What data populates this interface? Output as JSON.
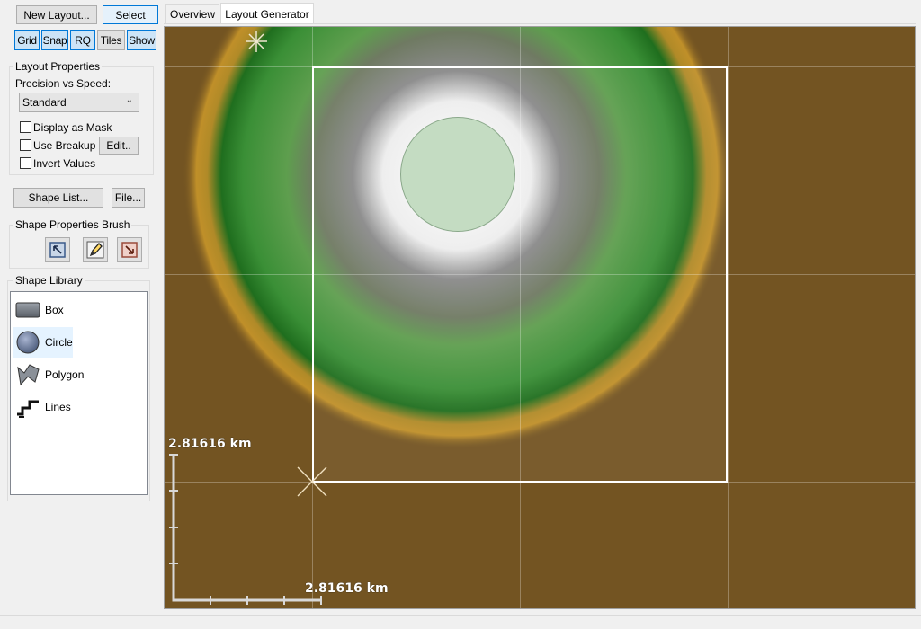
{
  "toolbar": {
    "new_layout": "New Layout...",
    "select": "Select",
    "toggles": [
      {
        "label": "Grid",
        "on": true
      },
      {
        "label": "Snap",
        "on": true
      },
      {
        "label": "RQ",
        "on": true
      },
      {
        "label": "Tiles",
        "on": false
      },
      {
        "label": "Show",
        "on": true
      }
    ]
  },
  "layout_properties": {
    "title": "Layout Properties",
    "precision_label": "Precision vs Speed:",
    "precision_value": "Standard",
    "display_as_mask": "Display as Mask",
    "use_breakup": "Use Breakup",
    "edit_button": "Edit..",
    "invert_values": "Invert Values"
  },
  "buttons": {
    "shape_list": "Shape List...",
    "file": "File..."
  },
  "brush": {
    "title": "Shape Properties Brush",
    "tools": [
      "select-brush-icon",
      "pencil-brush-icon",
      "erase-brush-icon"
    ]
  },
  "library": {
    "title": "Shape Library",
    "items": [
      {
        "label": "Box",
        "icon": "box-shape-icon"
      },
      {
        "label": "Circle",
        "icon": "circle-shape-icon",
        "selected": true
      },
      {
        "label": "Polygon",
        "icon": "polygon-shape-icon"
      },
      {
        "label": "Lines",
        "icon": "lines-shape-icon"
      }
    ]
  },
  "tabs": [
    {
      "label": "Overview",
      "active": false
    },
    {
      "label": "Layout Generator",
      "active": true
    }
  ],
  "viewport": {
    "scale_vertical": "2.81616 km",
    "scale_horizontal": "2.81616 km",
    "colors": {
      "terrain": "#735422",
      "ring_orange": "#c89a2a",
      "ring_green": "#2f8f2f",
      "center_fill": "#c4dcc2",
      "selection": "#ffffff"
    }
  }
}
